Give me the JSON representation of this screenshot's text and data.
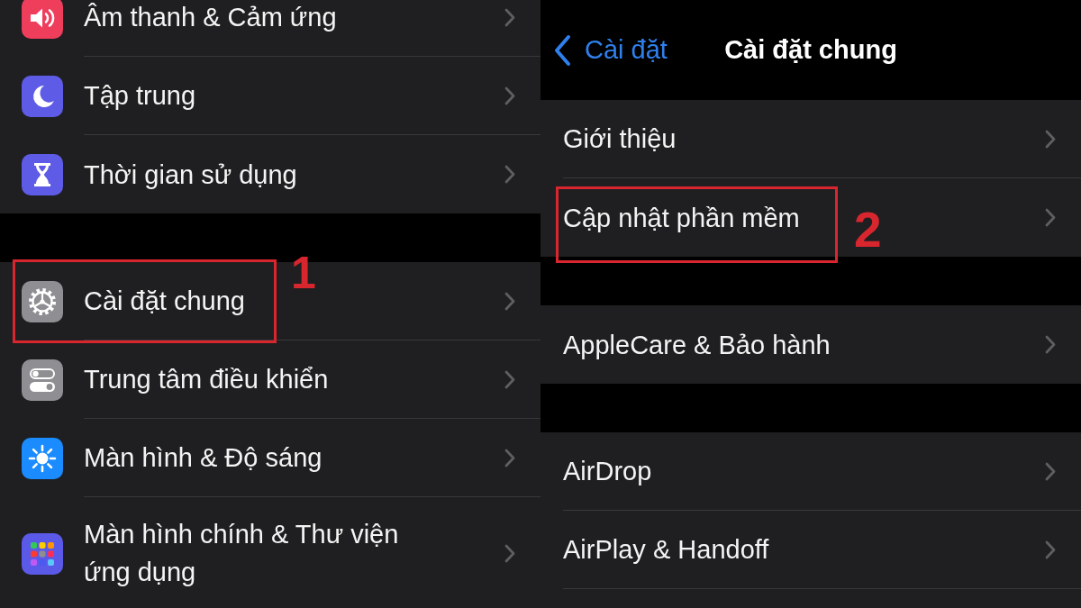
{
  "settings_list": {
    "groups": [
      {
        "items": [
          {
            "label": "Âm thanh & Cảm ứng",
            "highlighted": false
          },
          {
            "label": "Tập trung",
            "highlighted": false
          },
          {
            "label": "Thời gian sử dụng",
            "highlighted": false
          }
        ]
      },
      {
        "items": [
          {
            "label": "Cài đặt chung",
            "highlighted": true,
            "callout": "1"
          },
          {
            "label": "Trung tâm điều khiển",
            "highlighted": false
          },
          {
            "label": "Màn hình & Độ sáng",
            "highlighted": false
          },
          {
            "label": "Màn hình chính & Thư viện ứng dụng",
            "highlighted": false
          }
        ]
      }
    ]
  },
  "general_panel": {
    "back_label": "Cài đặt",
    "title": "Cài đặt chung",
    "groups": [
      {
        "items": [
          {
            "label": "Giới thiệu",
            "highlighted": false
          },
          {
            "label": "Cập nhật phần mềm",
            "highlighted": true,
            "callout": "2"
          }
        ]
      },
      {
        "items": [
          {
            "label": "AppleCare & Bảo hành",
            "highlighted": false
          }
        ]
      },
      {
        "items": [
          {
            "label": "AirDrop",
            "highlighted": false
          },
          {
            "label": "AirPlay & Handoff",
            "highlighted": false
          }
        ]
      }
    ]
  }
}
